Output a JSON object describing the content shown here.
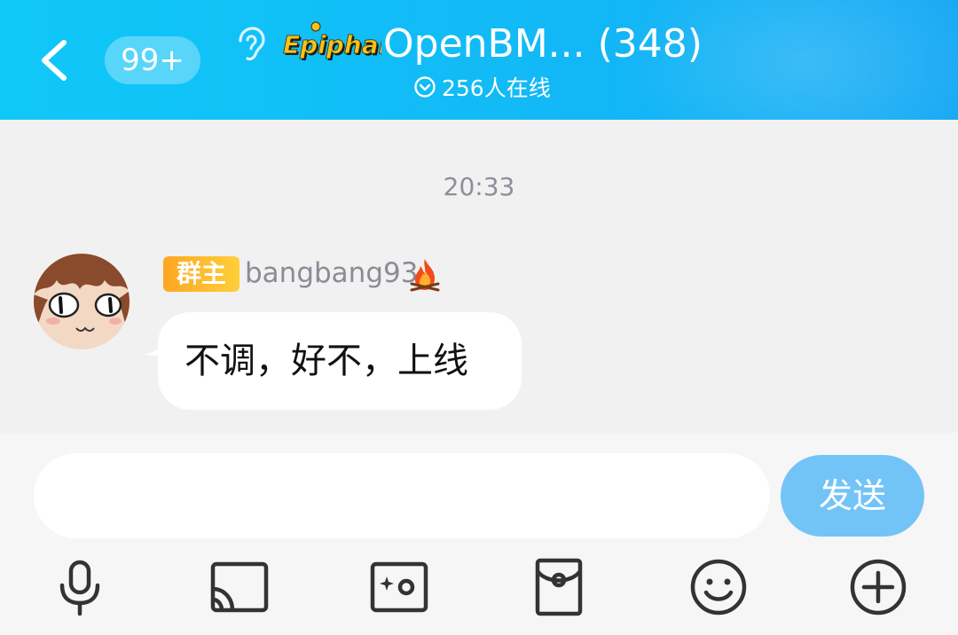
{
  "header": {
    "back_label": "返回",
    "unread_count": "99+",
    "logo_text": "Epiphany",
    "title": "OpenBM... (348)",
    "online_text": "256人在线"
  },
  "chat": {
    "timestamp": "20:33",
    "messages": [
      {
        "role_badge": "群主",
        "sender": "bangbang93",
        "text": "不调，好不，上线"
      }
    ]
  },
  "composer": {
    "input_value": "",
    "send_label": "发送"
  },
  "toolbar": {
    "icons": [
      "microphone-icon",
      "screen-share-icon",
      "photo-icon",
      "red-envelope-icon",
      "emoji-icon",
      "plus-icon"
    ]
  },
  "colors": {
    "header_start": "#10c8f8",
    "header_end": "#18a9f4",
    "send_button": "#72c4f7",
    "owner_badge": "#ffa621"
  }
}
